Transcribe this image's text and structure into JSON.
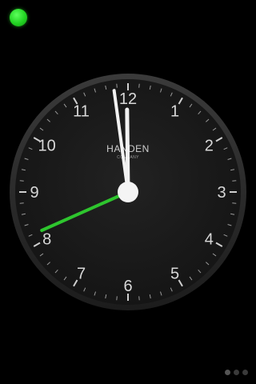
{
  "clock": {
    "brand": "HANDEN",
    "sub_brand": "COMPANY",
    "hour_numerals": [
      "12",
      "1",
      "2",
      "3",
      "4",
      "5",
      "6",
      "7",
      "8",
      "9",
      "10",
      "11"
    ],
    "time": {
      "hours": 11,
      "minutes": 58.7,
      "seconds": 41
    },
    "colors": {
      "face": "#1a1a1a",
      "bezel": "#2b2b2b",
      "numerals": "#d8d8d8",
      "ticks": "#9a9a9a",
      "hands": "#f2f2f2",
      "second_hand": "#2ec52e",
      "status_dot": "#22d322"
    }
  },
  "page_indicator": {
    "count": 3,
    "active": 0
  }
}
